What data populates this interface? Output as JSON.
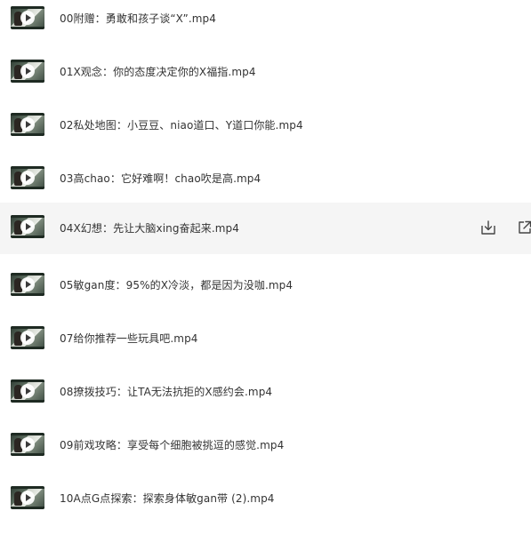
{
  "files": [
    {
      "name": "00附赠：勇敢和孩子谈“X”.mp4"
    },
    {
      "name": "01X观念：你的态度决定你的X福指.mp4"
    },
    {
      "name": "02私处地图：小豆豆、niao道口、Y道口你能.mp4"
    },
    {
      "name": "03高chao：它好难啊！chao吹是高.mp4"
    },
    {
      "name": "04X幻想：先让大脑xing奋起来.mp4"
    },
    {
      "name": "05敏gan度：95%的X冷淡，都是因为没咖.mp4"
    },
    {
      "name": "07给你推荐一些玩具吧.mp4"
    },
    {
      "name": "08撩拨技巧：让TA无法抗拒的X感约会.mp4"
    },
    {
      "name": "09前戏攻略：享受每个细胞被挑逗的感觉.mp4"
    },
    {
      "name": "10A点G点探索：探索身体敏gan带 (2).mp4"
    }
  ],
  "hovered_index": 4,
  "row_actions": {
    "download_icon": "download-icon",
    "share_icon": "external-share-icon"
  },
  "colors": {
    "text": "#333333",
    "hover_background": "#f5f5f5",
    "icon": "#444444"
  }
}
